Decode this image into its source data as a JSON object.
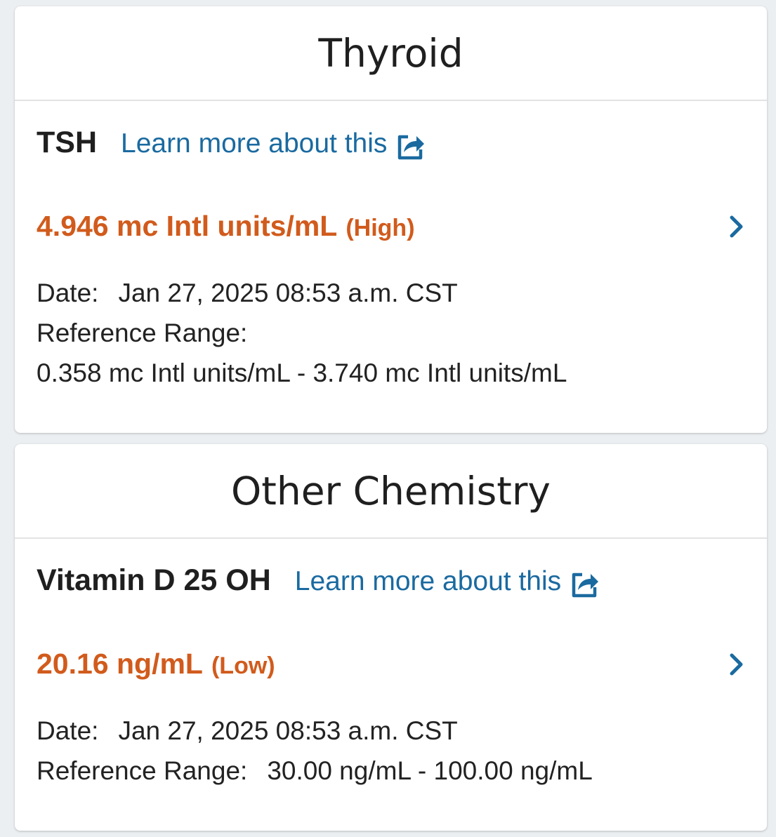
{
  "sections": [
    {
      "title": "Thyroid",
      "test_name": "TSH",
      "learn_more": "Learn more about this",
      "result_value": "4.946 mc Intl units/mL",
      "result_flag": "(High)",
      "date_label": "Date:",
      "date_value": "Jan 27, 2025 08:53 a.m. CST",
      "range_label": "Reference Range:",
      "range_value": "0.358 mc Intl units/mL - 3.740 mc Intl units/mL"
    },
    {
      "title": "Other Chemistry",
      "test_name": "Vitamin D 25 OH",
      "learn_more": "Learn more about this",
      "result_value": "20.16 ng/mL",
      "result_flag": "(Low)",
      "date_label": "Date:",
      "date_value": "Jan 27, 2025 08:53 a.m. CST",
      "range_label": "Reference Range:",
      "range_value": "30.00 ng/mL - 100.00 ng/mL"
    }
  ],
  "colors": {
    "abnormal": "#d15b1c",
    "link": "#1a6aa0",
    "text": "#1f1f1f"
  },
  "icons": [
    "external-link-icon",
    "chevron-right-icon"
  ]
}
